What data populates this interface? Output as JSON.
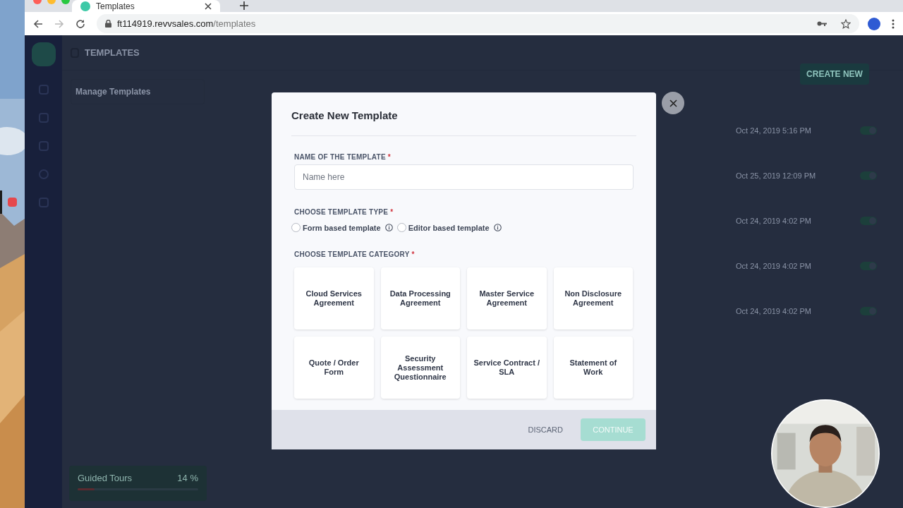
{
  "browser": {
    "tab_title": "Templates",
    "url_host": "ft114919.revvsales.com",
    "url_path": "/templates"
  },
  "app": {
    "header_title": "TEMPLATES",
    "sidebar_menu": [
      {
        "label": "Manage Templates"
      }
    ],
    "create_button": "CREATE NEW",
    "rows": [
      {
        "date": "Oct 24, 2019 5:16 PM",
        "enabled": true
      },
      {
        "date": "Oct 25, 2019 12:09 PM",
        "enabled": true
      },
      {
        "date": "Oct 24, 2019 4:02 PM",
        "enabled": true
      },
      {
        "date": "Oct 24, 2019 4:02 PM",
        "enabled": true
      },
      {
        "date": "Oct 24, 2019 4:02 PM",
        "enabled": true
      }
    ],
    "guided_tours": {
      "label": "Guided Tours",
      "percent": "14 %",
      "level": 0.14
    }
  },
  "modal": {
    "title": "Create New Template",
    "name_field": {
      "label": "NAME OF THE TEMPLATE",
      "required_mark": "*",
      "placeholder": "Name here"
    },
    "type_field": {
      "label": "CHOOSE TEMPLATE TYPE",
      "required_mark": "*",
      "options": [
        {
          "label": "Form based template",
          "selected": false
        },
        {
          "label": "Editor based template",
          "selected": false
        }
      ]
    },
    "category_field": {
      "label": "CHOOSE TEMPLATE CATEGORY",
      "required_mark": "*",
      "options": [
        {
          "label": "Cloud Services Agreement"
        },
        {
          "label": "Data Processing Agreement"
        },
        {
          "label": "Master Service Agreement"
        },
        {
          "label": "Non Disclosure Agreement"
        },
        {
          "label": "Quote / Order Form"
        },
        {
          "label": "Security Assessment Questionnaire"
        },
        {
          "label": "Service Contract / SLA"
        },
        {
          "label": "Statement of Work"
        }
      ]
    },
    "buttons": [
      {
        "label": "DISCARD",
        "kind": "text",
        "disabled": false
      },
      {
        "label": "CONTINUE",
        "kind": "primary",
        "disabled": true
      }
    ]
  }
}
